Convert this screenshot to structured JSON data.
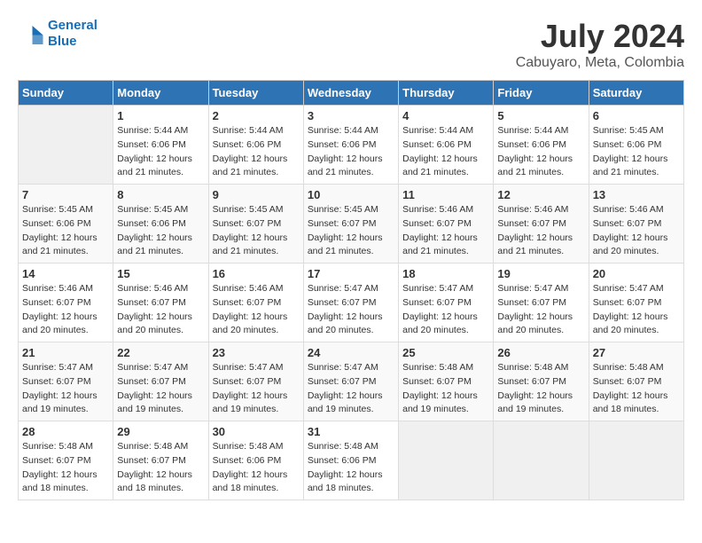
{
  "logo": {
    "line1": "General",
    "line2": "Blue"
  },
  "title": "July 2024",
  "subtitle": "Cabuyaro, Meta, Colombia",
  "weekdays": [
    "Sunday",
    "Monday",
    "Tuesday",
    "Wednesday",
    "Thursday",
    "Friday",
    "Saturday"
  ],
  "weeks": [
    [
      {
        "num": "",
        "info": ""
      },
      {
        "num": "1",
        "info": "Sunrise: 5:44 AM\nSunset: 6:06 PM\nDaylight: 12 hours\nand 21 minutes."
      },
      {
        "num": "2",
        "info": "Sunrise: 5:44 AM\nSunset: 6:06 PM\nDaylight: 12 hours\nand 21 minutes."
      },
      {
        "num": "3",
        "info": "Sunrise: 5:44 AM\nSunset: 6:06 PM\nDaylight: 12 hours\nand 21 minutes."
      },
      {
        "num": "4",
        "info": "Sunrise: 5:44 AM\nSunset: 6:06 PM\nDaylight: 12 hours\nand 21 minutes."
      },
      {
        "num": "5",
        "info": "Sunrise: 5:44 AM\nSunset: 6:06 PM\nDaylight: 12 hours\nand 21 minutes."
      },
      {
        "num": "6",
        "info": "Sunrise: 5:45 AM\nSunset: 6:06 PM\nDaylight: 12 hours\nand 21 minutes."
      }
    ],
    [
      {
        "num": "7",
        "info": "Sunrise: 5:45 AM\nSunset: 6:06 PM\nDaylight: 12 hours\nand 21 minutes."
      },
      {
        "num": "8",
        "info": "Sunrise: 5:45 AM\nSunset: 6:06 PM\nDaylight: 12 hours\nand 21 minutes."
      },
      {
        "num": "9",
        "info": "Sunrise: 5:45 AM\nSunset: 6:07 PM\nDaylight: 12 hours\nand 21 minutes."
      },
      {
        "num": "10",
        "info": "Sunrise: 5:45 AM\nSunset: 6:07 PM\nDaylight: 12 hours\nand 21 minutes."
      },
      {
        "num": "11",
        "info": "Sunrise: 5:46 AM\nSunset: 6:07 PM\nDaylight: 12 hours\nand 21 minutes."
      },
      {
        "num": "12",
        "info": "Sunrise: 5:46 AM\nSunset: 6:07 PM\nDaylight: 12 hours\nand 21 minutes."
      },
      {
        "num": "13",
        "info": "Sunrise: 5:46 AM\nSunset: 6:07 PM\nDaylight: 12 hours\nand 20 minutes."
      }
    ],
    [
      {
        "num": "14",
        "info": "Sunrise: 5:46 AM\nSunset: 6:07 PM\nDaylight: 12 hours\nand 20 minutes."
      },
      {
        "num": "15",
        "info": "Sunrise: 5:46 AM\nSunset: 6:07 PM\nDaylight: 12 hours\nand 20 minutes."
      },
      {
        "num": "16",
        "info": "Sunrise: 5:46 AM\nSunset: 6:07 PM\nDaylight: 12 hours\nand 20 minutes."
      },
      {
        "num": "17",
        "info": "Sunrise: 5:47 AM\nSunset: 6:07 PM\nDaylight: 12 hours\nand 20 minutes."
      },
      {
        "num": "18",
        "info": "Sunrise: 5:47 AM\nSunset: 6:07 PM\nDaylight: 12 hours\nand 20 minutes."
      },
      {
        "num": "19",
        "info": "Sunrise: 5:47 AM\nSunset: 6:07 PM\nDaylight: 12 hours\nand 20 minutes."
      },
      {
        "num": "20",
        "info": "Sunrise: 5:47 AM\nSunset: 6:07 PM\nDaylight: 12 hours\nand 20 minutes."
      }
    ],
    [
      {
        "num": "21",
        "info": "Sunrise: 5:47 AM\nSunset: 6:07 PM\nDaylight: 12 hours\nand 19 minutes."
      },
      {
        "num": "22",
        "info": "Sunrise: 5:47 AM\nSunset: 6:07 PM\nDaylight: 12 hours\nand 19 minutes."
      },
      {
        "num": "23",
        "info": "Sunrise: 5:47 AM\nSunset: 6:07 PM\nDaylight: 12 hours\nand 19 minutes."
      },
      {
        "num": "24",
        "info": "Sunrise: 5:47 AM\nSunset: 6:07 PM\nDaylight: 12 hours\nand 19 minutes."
      },
      {
        "num": "25",
        "info": "Sunrise: 5:48 AM\nSunset: 6:07 PM\nDaylight: 12 hours\nand 19 minutes."
      },
      {
        "num": "26",
        "info": "Sunrise: 5:48 AM\nSunset: 6:07 PM\nDaylight: 12 hours\nand 19 minutes."
      },
      {
        "num": "27",
        "info": "Sunrise: 5:48 AM\nSunset: 6:07 PM\nDaylight: 12 hours\nand 18 minutes."
      }
    ],
    [
      {
        "num": "28",
        "info": "Sunrise: 5:48 AM\nSunset: 6:07 PM\nDaylight: 12 hours\nand 18 minutes."
      },
      {
        "num": "29",
        "info": "Sunrise: 5:48 AM\nSunset: 6:07 PM\nDaylight: 12 hours\nand 18 minutes."
      },
      {
        "num": "30",
        "info": "Sunrise: 5:48 AM\nSunset: 6:06 PM\nDaylight: 12 hours\nand 18 minutes."
      },
      {
        "num": "31",
        "info": "Sunrise: 5:48 AM\nSunset: 6:06 PM\nDaylight: 12 hours\nand 18 minutes."
      },
      {
        "num": "",
        "info": ""
      },
      {
        "num": "",
        "info": ""
      },
      {
        "num": "",
        "info": ""
      }
    ]
  ]
}
